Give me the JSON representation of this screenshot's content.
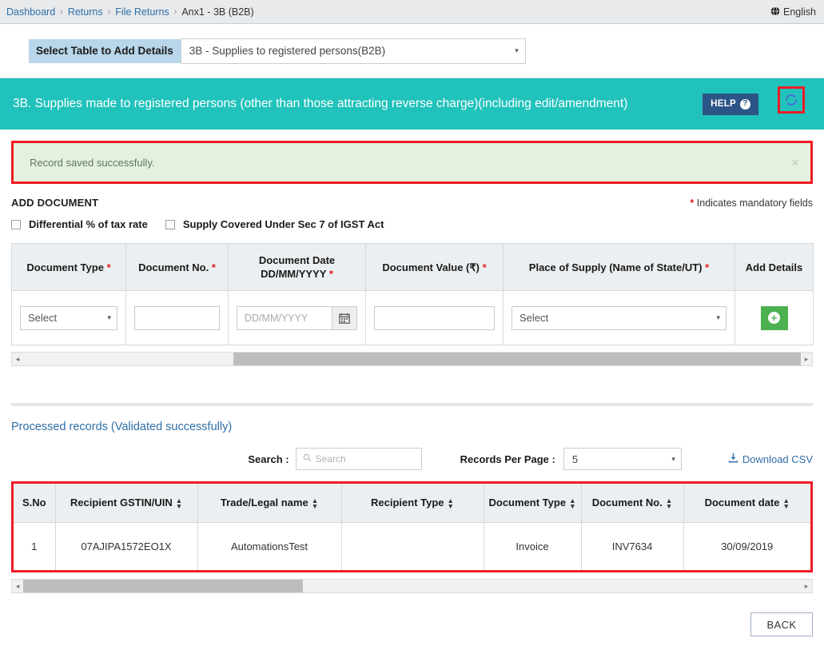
{
  "breadcrumb": {
    "items": [
      "Dashboard",
      "Returns",
      "File Returns",
      "Anx1 - 3B (B2B)"
    ],
    "separator": "›"
  },
  "language": {
    "label": "English",
    "icon": "globe-icon"
  },
  "select_table": {
    "label": "Select Table to Add Details",
    "value": "3B - Supplies to registered persons(B2B)",
    "caret": "▾"
  },
  "section_header": {
    "title": "3B. Supplies made to registered persons (other than those attracting reverse charge)(including edit/amendment)",
    "help_label": "HELP",
    "help_icon": "?",
    "refresh_icon": "refresh-icon",
    "background": "#20c2bb",
    "highlight_color": "#ee1c25"
  },
  "alert": {
    "message": "Record saved successfully.",
    "close": "×",
    "background": "#e5f0e0",
    "text_color": "#5d7a56"
  },
  "add_document": {
    "title": "ADD DOCUMENT",
    "mandatory_note_star": "*",
    "mandatory_note": " Indicates mandatory fields",
    "checkboxes": [
      {
        "label": "Differential % of tax rate",
        "checked": false
      },
      {
        "label": "Supply Covered Under Sec 7 of IGST Act",
        "checked": false
      }
    ],
    "columns": [
      {
        "label": "Document Type",
        "required": true
      },
      {
        "label": "Document No.",
        "required": true
      },
      {
        "label": "Document Date",
        "label2": "DD/MM/YYYY",
        "required": true
      },
      {
        "label": "Document Value (₹)",
        "required": true
      },
      {
        "label": "Place of Supply (Name of State/UT)",
        "required": true
      },
      {
        "label": "Add Details",
        "required": false
      }
    ],
    "fields": {
      "document_type": {
        "value": "Select",
        "caret": "▾"
      },
      "document_no": {
        "value": ""
      },
      "document_date": {
        "placeholder": "DD/MM/YYYY",
        "value": "",
        "calendar_icon": "📅"
      },
      "document_value": {
        "value": ""
      },
      "place_of_supply": {
        "value": "Select",
        "caret": "▾"
      },
      "add_details_button": {
        "icon": "plus-icon",
        "label": "+"
      }
    }
  },
  "top_scrollbar": {
    "left_arrow": "◂",
    "right_arrow": "▸",
    "thumb_left_pct": 27,
    "thumb_width_pct": 73
  },
  "bottom_scrollbar": {
    "left_arrow": "◂",
    "right_arrow": "▸",
    "thumb_left_pct": 0,
    "thumb_width_pct": 36
  },
  "processed": {
    "title": "Processed records (Validated successfully)",
    "search_label": "Search :",
    "search_placeholder": "Search",
    "search_value": "",
    "search_icon": "search-icon",
    "records_per_page_label": "Records Per Page :",
    "records_per_page_value": "5",
    "caret": "▾",
    "download_csv_label": "Download CSV",
    "download_icon": "download-icon",
    "columns": [
      {
        "label": "S.No",
        "sortable": false
      },
      {
        "label": "Recipient GSTIN/UIN",
        "sortable": true
      },
      {
        "label": "Trade/Legal name",
        "sortable": true
      },
      {
        "label": "Recipient Type",
        "sortable": true
      },
      {
        "label": "Document Type",
        "sortable": true
      },
      {
        "label": "Document No.",
        "sortable": true
      },
      {
        "label": "Document date",
        "sortable": true
      }
    ],
    "rows": [
      {
        "sno": "1",
        "gstin": "07AJIPA1572EO1X",
        "trade_name": "AutomationsTest",
        "recipient_type": "",
        "document_type": "Invoice",
        "document_no": "INV7634",
        "document_date": "30/09/2019"
      }
    ],
    "highlight_color": "#ee1c25"
  },
  "footer": {
    "back_label": "BACK"
  }
}
